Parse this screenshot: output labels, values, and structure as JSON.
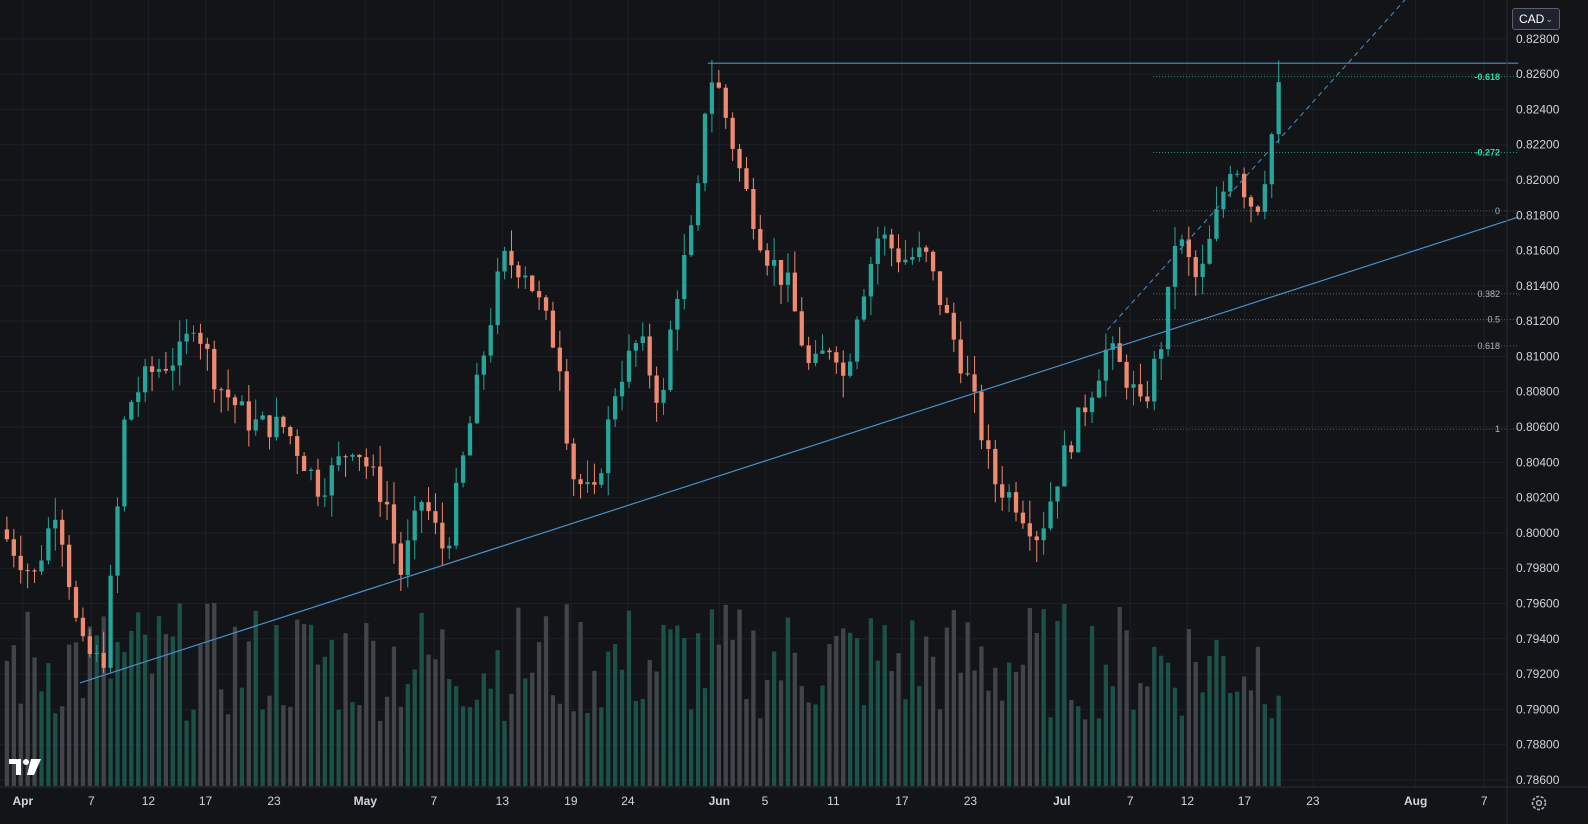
{
  "toolbar": {
    "currency_label": "CAD"
  },
  "icons": {
    "logo": "tradingview-logo-icon",
    "settings": "gear-icon",
    "dropdown": "chevron-down-icon"
  },
  "colors": {
    "background": "#121417",
    "up": "#26a69a",
    "down": "#ef8a70",
    "volume_up": "#1d5c52",
    "volume_down": "#4a4c52",
    "trendline": "#4a90c8",
    "fib_accent": "#26d9a8",
    "fib_neutral": "#b2b5be"
  },
  "chart_data": {
    "type": "candlestick",
    "y_axis": {
      "ylim": [
        0.7856,
        0.8302
      ],
      "tick_labels": [
        "0.82800",
        "0.82600",
        "0.82400",
        "0.82200",
        "0.82000",
        "0.81800",
        "0.81600",
        "0.81400",
        "0.81200",
        "0.81000",
        "0.80800",
        "0.80600",
        "0.80400",
        "0.80200",
        "0.80000",
        "0.79800",
        "0.79600",
        "0.79400",
        "0.79200",
        "0.79000",
        "0.78800",
        "0.78600"
      ]
    },
    "x_axis": {
      "start_date": "2025-03-30",
      "end_date": "2025-08-09",
      "tick_labels": [
        {
          "label": "Apr",
          "date": "2025-04-01",
          "bold": true
        },
        {
          "label": "7",
          "date": "2025-04-07"
        },
        {
          "label": "12",
          "date": "2025-04-12"
        },
        {
          "label": "17",
          "date": "2025-04-17"
        },
        {
          "label": "23",
          "date": "2025-04-23"
        },
        {
          "label": "May",
          "date": "2025-05-01",
          "bold": true
        },
        {
          "label": "7",
          "date": "2025-05-07"
        },
        {
          "label": "13",
          "date": "2025-05-13"
        },
        {
          "label": "19",
          "date": "2025-05-19"
        },
        {
          "label": "24",
          "date": "2025-05-24"
        },
        {
          "label": "Jun",
          "date": "2025-06-01",
          "bold": true
        },
        {
          "label": "5",
          "date": "2025-06-05"
        },
        {
          "label": "11",
          "date": "2025-06-11"
        },
        {
          "label": "17",
          "date": "2025-06-17"
        },
        {
          "label": "23",
          "date": "2025-06-23"
        },
        {
          "label": "Jul",
          "date": "2025-07-01",
          "bold": true
        },
        {
          "label": "7",
          "date": "2025-07-07"
        },
        {
          "label": "12",
          "date": "2025-07-12"
        },
        {
          "label": "17",
          "date": "2025-07-17"
        },
        {
          "label": "23",
          "date": "2025-07-23"
        },
        {
          "label": "Aug",
          "date": "2025-08-01",
          "bold": true
        },
        {
          "label": "7",
          "date": "2025-08-07"
        }
      ]
    },
    "price_path": [
      [
        "2025-03-30",
        0.8002
      ],
      [
        "2025-04-02",
        0.7975
      ],
      [
        "2025-04-04",
        0.8018
      ],
      [
        "2025-04-06",
        0.7935
      ],
      [
        "2025-04-08",
        0.7925
      ],
      [
        "2025-04-09",
        0.799
      ],
      [
        "2025-04-10",
        0.807
      ],
      [
        "2025-04-12",
        0.809
      ],
      [
        "2025-04-15",
        0.8102
      ],
      [
        "2025-04-16",
        0.8122
      ],
      [
        "2025-04-18",
        0.8085
      ],
      [
        "2025-04-21",
        0.8062
      ],
      [
        "2025-04-24",
        0.806
      ],
      [
        "2025-04-27",
        0.8025
      ],
      [
        "2025-04-30",
        0.8052
      ],
      [
        "2025-05-03",
        0.8015
      ],
      [
        "2025-05-04",
        0.7975
      ],
      [
        "2025-05-06",
        0.802
      ],
      [
        "2025-05-08",
        0.7988
      ],
      [
        "2025-05-11",
        0.809
      ],
      [
        "2025-05-13",
        0.8155
      ],
      [
        "2025-05-15",
        0.815
      ],
      [
        "2025-05-18",
        0.81
      ],
      [
        "2025-05-19",
        0.8035
      ],
      [
        "2025-05-21",
        0.8018
      ],
      [
        "2025-05-23",
        0.8085
      ],
      [
        "2025-05-25",
        0.811
      ],
      [
        "2025-05-27",
        0.807
      ],
      [
        "2025-05-28",
        0.813
      ],
      [
        "2025-05-30",
        0.818
      ],
      [
        "2025-05-31",
        0.8262
      ],
      [
        "2025-06-01",
        0.825
      ],
      [
        "2025-06-03",
        0.82
      ],
      [
        "2025-06-05",
        0.816
      ],
      [
        "2025-06-07",
        0.814
      ],
      [
        "2025-06-09",
        0.809
      ],
      [
        "2025-06-11",
        0.811
      ],
      [
        "2025-06-12",
        0.8085
      ],
      [
        "2025-06-13",
        0.8125
      ],
      [
        "2025-06-15",
        0.817
      ],
      [
        "2025-06-17",
        0.8155
      ],
      [
        "2025-06-19",
        0.8158
      ],
      [
        "2025-06-21",
        0.812
      ],
      [
        "2025-06-23",
        0.8082
      ],
      [
        "2025-06-25",
        0.803
      ],
      [
        "2025-06-27",
        0.8018
      ],
      [
        "2025-06-29",
        0.7998
      ],
      [
        "2025-07-01",
        0.804
      ],
      [
        "2025-07-03",
        0.8072
      ],
      [
        "2025-07-05",
        0.8105
      ],
      [
        "2025-07-07",
        0.8085
      ],
      [
        "2025-07-08",
        0.8068
      ],
      [
        "2025-07-10",
        0.8115
      ],
      [
        "2025-07-11",
        0.817
      ],
      [
        "2025-07-13",
        0.814
      ],
      [
        "2025-07-15",
        0.819
      ],
      [
        "2025-07-16",
        0.8215
      ],
      [
        "2025-07-17",
        0.8195
      ],
      [
        "2025-07-18",
        0.8182
      ],
      [
        "2025-07-19",
        0.821
      ],
      [
        "2025-07-20",
        0.825
      ]
    ],
    "candle_count": 185,
    "trendline": {
      "points": [
        [
          "2025-04-06",
          0.7915
        ],
        [
          "2025-08-10",
          0.8179
        ]
      ],
      "extends": "right"
    },
    "horizontal_resistance": {
      "price": 0.82662,
      "from": "2025-05-31",
      "to": "2025-08-10"
    },
    "projection_line": {
      "from": [
        "2025-07-05",
        0.8115
      ],
      "to": [
        "2025-08-02",
        0.8316
      ],
      "style": "dashed"
    },
    "fib_levels": [
      {
        "label": "-0.618",
        "price": 0.82585,
        "accent": true
      },
      {
        "label": "-0.272",
        "price": 0.82155,
        "accent": true
      },
      {
        "label": "0",
        "price": 0.81825,
        "accent": false
      },
      {
        "label": "0.382",
        "price": 0.81355,
        "accent": false
      },
      {
        "label": "0.5",
        "price": 0.8121,
        "accent": false
      },
      {
        "label": "0.618",
        "price": 0.8106,
        "accent": false
      },
      {
        "label": "1",
        "price": 0.80588,
        "accent": false
      }
    ],
    "fib_range": {
      "from": "2025-07-09",
      "to": "2025-08-10"
    }
  }
}
